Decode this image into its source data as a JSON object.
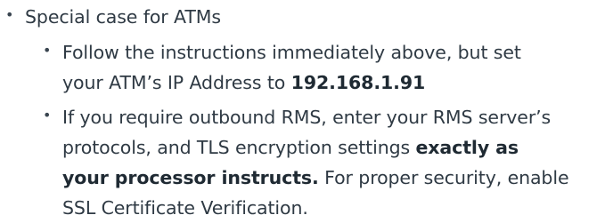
{
  "list": {
    "top_item": "Special case for ATMs",
    "sub_items": [
      {
        "line1": "Follow the instructions immediately above, but set",
        "line2_plain": "your ATM’s IP Address to ",
        "line2_bold": "192.168.1.91"
      },
      {
        "line1": "If you require outbound RMS, enter your RMS server’s",
        "line2_plain": "protocols, and TLS encryption settings ",
        "line2_bold": "exactly as",
        "line3_bold": "your processor instructs.",
        "line3_plain": " For proper security, enable",
        "line4": "SSL Certificate Verification."
      }
    ],
    "bullet_glyph": "•"
  }
}
